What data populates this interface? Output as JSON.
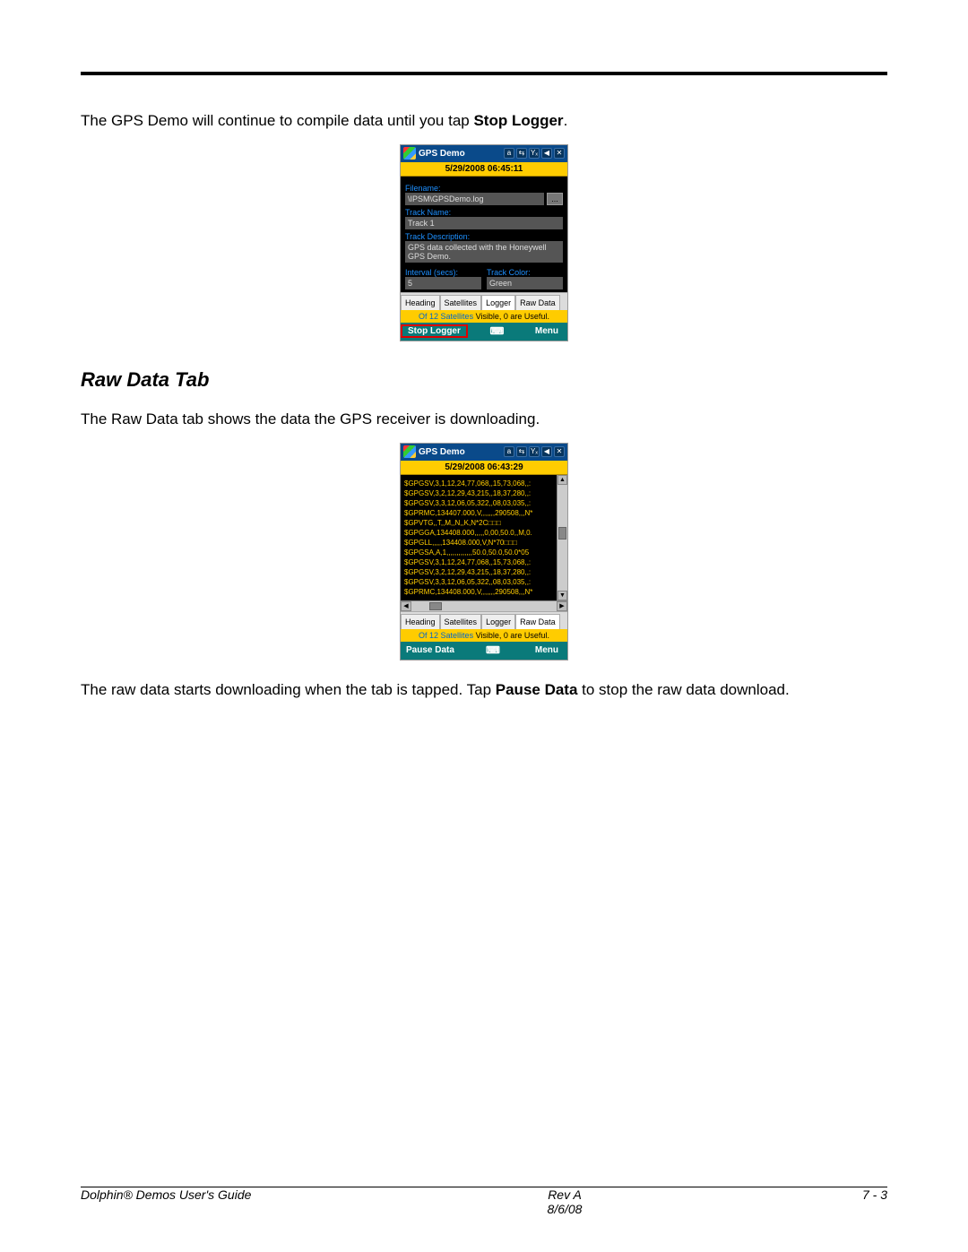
{
  "para1_pre": "The GPS Demo will continue to compile data until you tap ",
  "para1_bold": "Stop Logger",
  "para1_post": ".",
  "heading": "Raw Data Tab",
  "para2": "The Raw Data tab shows the data the GPS receiver is downloading.",
  "para3_pre": "The raw data starts downloading when the tab is tapped. Tap ",
  "para3_bold": "Pause Data",
  "para3_post": " to stop the raw data download.",
  "s1": {
    "title": "GPS Demo",
    "datetime": "5/29/2008 06:45:11",
    "filename_label": "Filename:",
    "filename": "\\IPSM\\GPSDemo.log",
    "browse": "...",
    "trackname_label": "Track Name:",
    "trackname": "Track 1",
    "trackdesc_label": "Track Description:",
    "trackdesc": "GPS data collected with the Honeywell GPS Demo.",
    "interval_label": "Interval (secs):",
    "interval": "5",
    "color_label": "Track Color:",
    "color": "Green",
    "tabs": [
      "Heading",
      "Satellites",
      "Logger",
      "Raw Data"
    ],
    "sat_status_a": "Of 12 Satellites",
    "sat_status_b": " Visible, 0 are Useful.",
    "left_btn": "Stop Logger",
    "right_btn": "Menu",
    "sip": "⌨"
  },
  "s2": {
    "title": "GPS Demo",
    "datetime": "5/29/2008 06:43:29",
    "raw_lines": [
      "$GPGSV,3,1,12,24,77,068,,15,73,068,,:",
      "$GPGSV,3,2,12,29,43,215,,18,37,280,,:",
      "$GPGSV,3,3,12,06,05,322,,08,03,035,,:",
      "$GPRMC,134407.000,V,,,,,,,290508,,,N*",
      "$GPVTG,,T,,M,,N,,K,N*2C□□□",
      "$GPGGA,134408.000,,,,,0,00,50.0,,M,0.",
      "$GPGLL,,,,,134408.000,V,N*70□□□",
      "$GPGSA,A,1,,,,,,,,,,,,,50.0,50.0,50.0*05",
      "$GPGSV,3,1,12,24,77,068,,15,73,068,,:",
      "$GPGSV,3,2,12,29,43,215,,18,37,280,,:",
      "$GPGSV,3,3,12,06,05,322,,08,03,035,,:",
      "$GPRMC,134408.000,V,,,,,,,290508,,,N*"
    ],
    "tabs": [
      "Heading",
      "Satellites",
      "Logger",
      "Raw Data"
    ],
    "sat_status_a": "Of 12 Satellites",
    "sat_status_b": " Visible, 0 are Useful.",
    "left_btn": "Pause Data",
    "right_btn": "Menu",
    "sip": "⌨"
  },
  "footer": {
    "left": "Dolphin® Demos User's Guide",
    "rev": "Rev A",
    "date": "8/6/08",
    "page": "7 - 3"
  }
}
